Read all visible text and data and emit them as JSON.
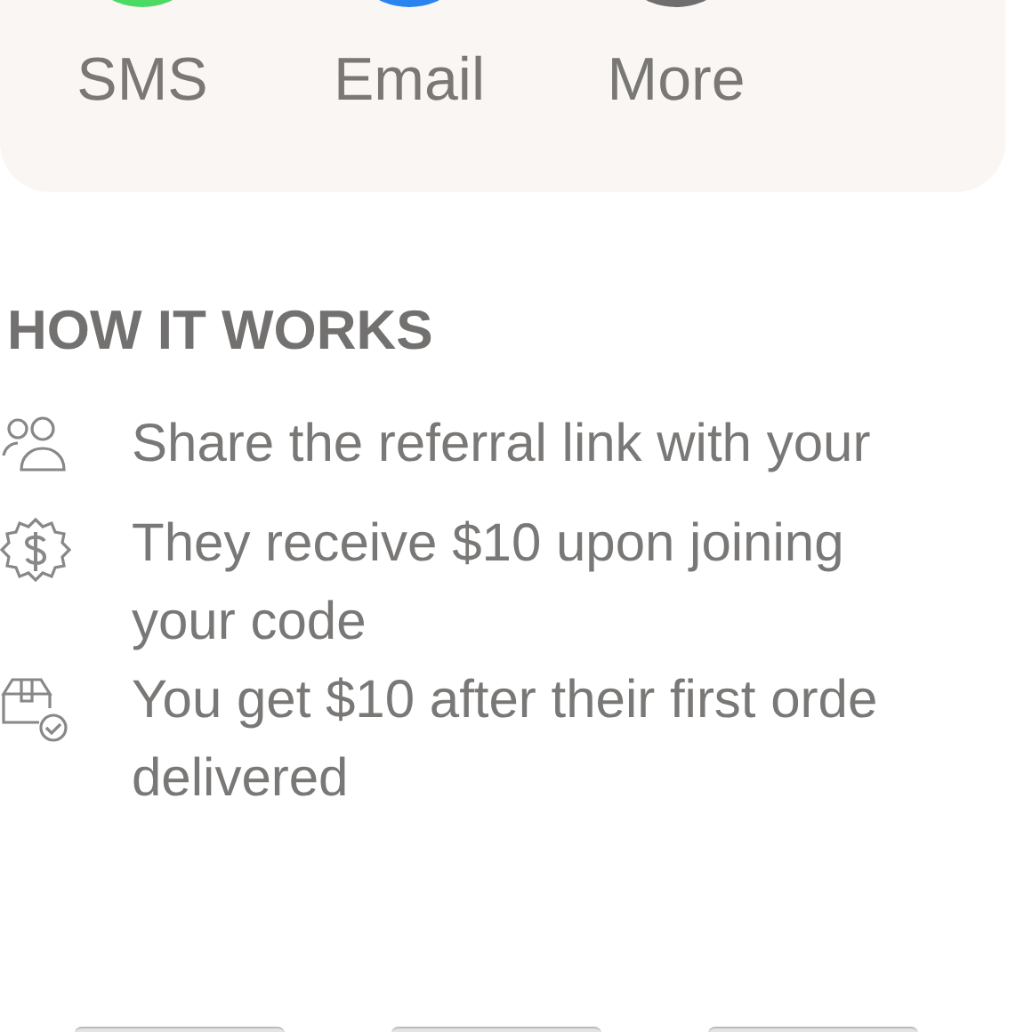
{
  "share_options": [
    {
      "label": "SMS",
      "color": "#4cd964"
    },
    {
      "label": "Email",
      "color": "#2a84f0"
    },
    {
      "label": "More",
      "color": "#6e6e6e"
    }
  ],
  "how_it_works": {
    "title": "HOW IT WORKS",
    "steps": [
      {
        "kind": "people",
        "lines": [
          "Share the referral link with your"
        ]
      },
      {
        "kind": "money",
        "lines": [
          "They receive $10 upon joining",
          "your code"
        ]
      },
      {
        "kind": "delivery",
        "lines": [
          "You get $10 after their first orde",
          "delivered"
        ]
      }
    ]
  },
  "bottom_buttons": [
    {
      "kind": "button"
    },
    {
      "kind": "button"
    },
    {
      "kind": "button"
    }
  ]
}
